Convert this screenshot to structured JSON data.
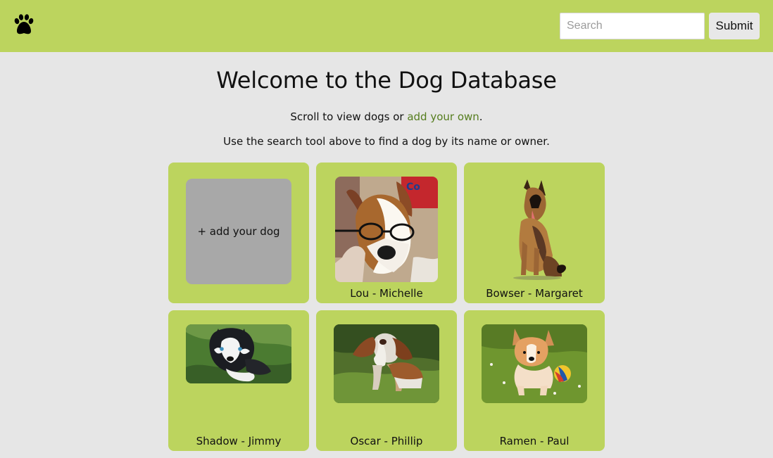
{
  "header": {
    "logo_icon": "paw-icon",
    "search_placeholder": "Search",
    "submit_label": "Submit",
    "bar_color": "#bcd45e"
  },
  "main": {
    "title": "Welcome to the Dog Database",
    "intro_before": "Scroll to view dogs or ",
    "intro_link": "add your own",
    "intro_after": ".",
    "search_hint": "Use the search tool above to find a dog by its name or owner."
  },
  "cards": {
    "add_label": "+ add your dog",
    "dogs": [
      {
        "label": "Lou - Michelle"
      },
      {
        "label": "Bowser - Margaret"
      },
      {
        "label": "Shadow - Jimmy"
      },
      {
        "label": "Oscar - Phillip"
      },
      {
        "label": "Ramen - Paul"
      }
    ]
  }
}
